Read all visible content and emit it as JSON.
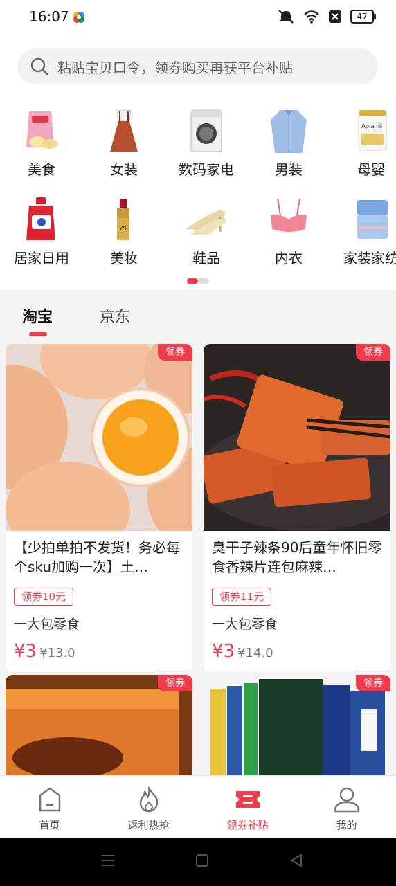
{
  "status_bar": {
    "time": "16:07",
    "battery": "47"
  },
  "search": {
    "placeholder": "粘贴宝贝口令，领券购买再获平台补贴"
  },
  "categories": [
    {
      "label": "美食",
      "icon": "snack-bag-icon"
    },
    {
      "label": "女装",
      "icon": "dress-icon"
    },
    {
      "label": "数码家电",
      "icon": "washing-machine-icon"
    },
    {
      "label": "男装",
      "icon": "shirt-icon"
    },
    {
      "label": "母婴",
      "icon": "formula-can-icon"
    },
    {
      "label": "居家日用",
      "icon": "detergent-icon"
    },
    {
      "label": "美妆",
      "icon": "lipstick-icon"
    },
    {
      "label": "鞋品",
      "icon": "heels-icon"
    },
    {
      "label": "内衣",
      "icon": "bra-icon"
    },
    {
      "label": "家装家纺",
      "icon": "bedding-icon"
    }
  ],
  "tabs": [
    {
      "label": "淘宝",
      "active": true
    },
    {
      "label": "京东",
      "active": false
    }
  ],
  "products": [
    {
      "badge": "领券",
      "title": "【少拍单拍不发货！务必每个sku加购一次】土…",
      "coupon": "领券10元",
      "subtitle": "一大包零食",
      "price": "¥3",
      "original_price": "¥13.0"
    },
    {
      "badge": "领券",
      "title": "臭干子辣条90后童年怀旧零食香辣片连包麻辣…",
      "coupon": "领券11元",
      "subtitle": "一大包零食",
      "price": "¥3",
      "original_price": "¥14.0"
    },
    {
      "badge": "领券"
    },
    {
      "badge": "领券"
    }
  ],
  "bottom_nav": [
    {
      "label": "首页",
      "icon": "home-icon"
    },
    {
      "label": "返利热抢",
      "icon": "flame-icon"
    },
    {
      "label": "领券补贴",
      "icon": "coupon-ticket-icon",
      "active": true
    },
    {
      "label": "我的",
      "icon": "profile-icon"
    }
  ],
  "colors": {
    "accent": "#ef3b4a",
    "page_bg": "#f4f4f4"
  }
}
